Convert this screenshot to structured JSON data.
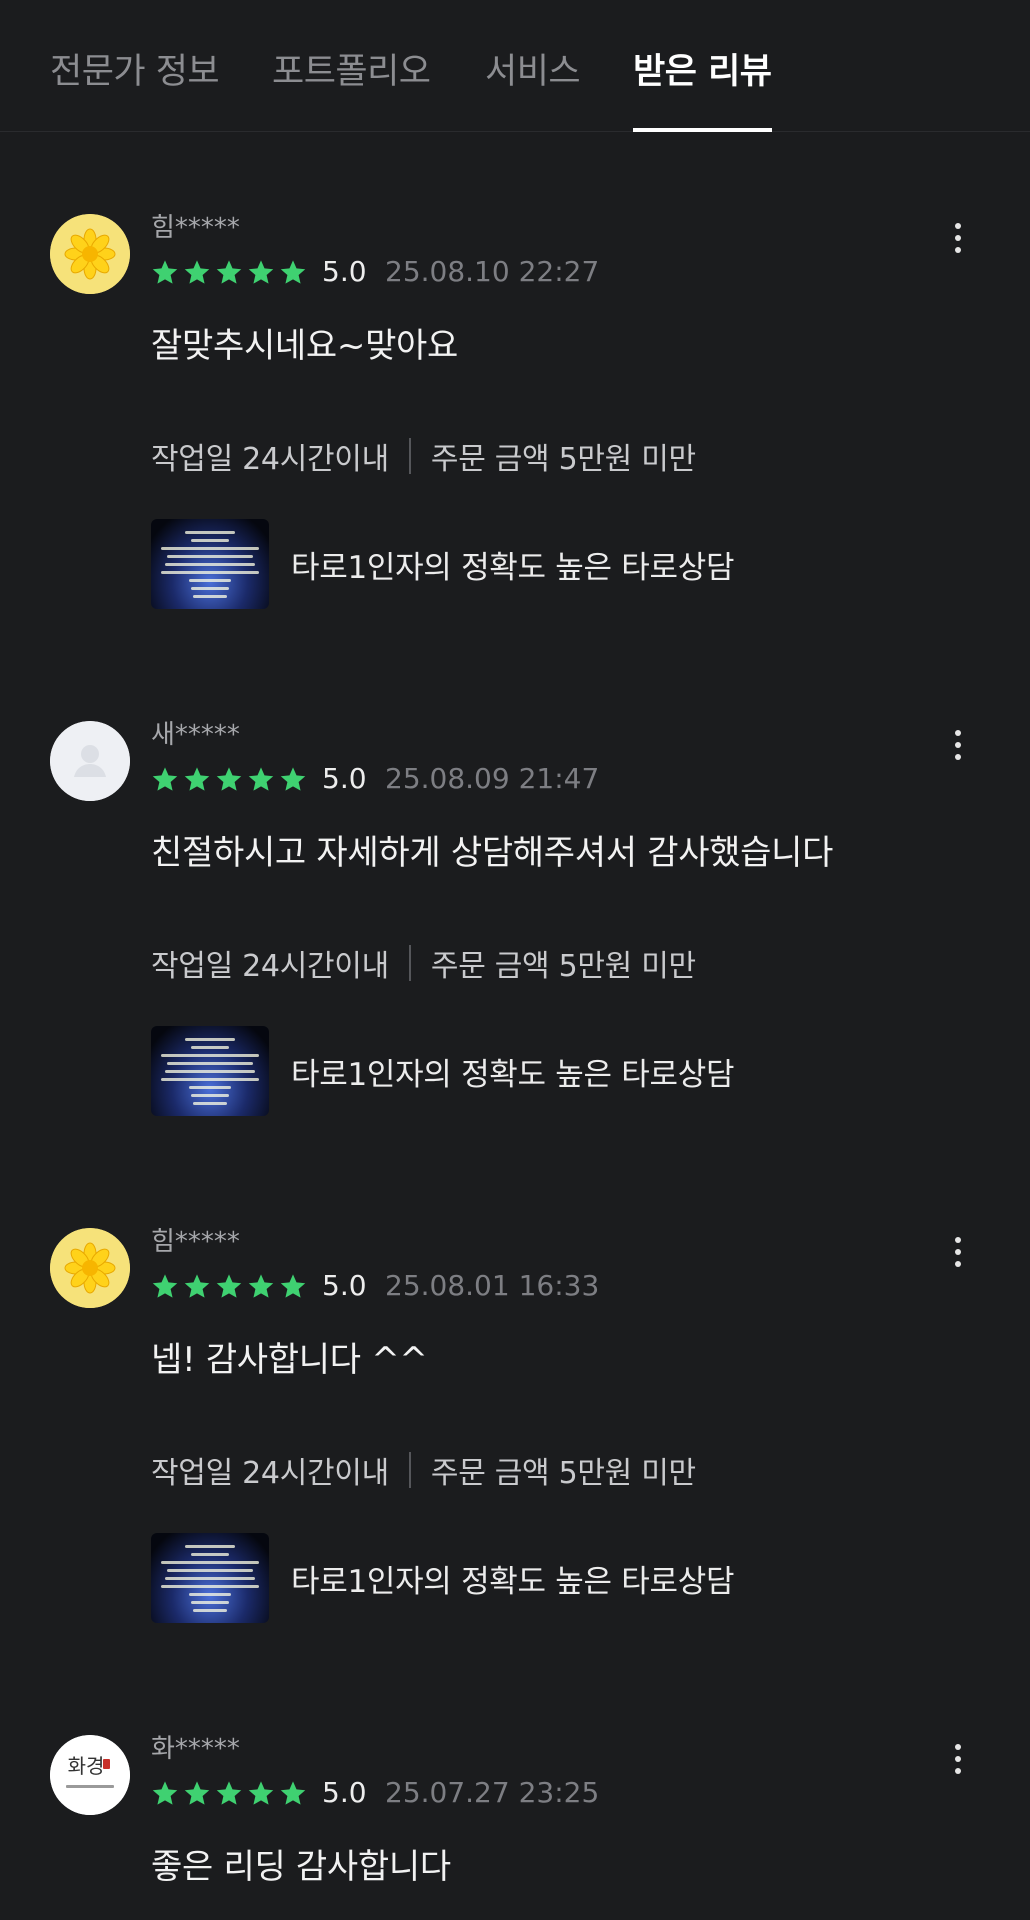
{
  "tabs": [
    {
      "label": "전문가 정보"
    },
    {
      "label": "포트폴리오"
    },
    {
      "label": "서비스"
    },
    {
      "label": "받은 리뷰"
    }
  ],
  "active_tab": "받은 리뷰",
  "colors": {
    "background": "#1b1c1e",
    "star": "#3fd171",
    "active_tab": "#ffffff",
    "inactive_tab": "#8c8d91"
  },
  "reviews": [
    {
      "avatar_icon": "flower-avatar-icon",
      "name": "힘*****",
      "rating_stars": 5,
      "score": "5.0",
      "date": "25.08.10 22:27",
      "comment": "잘맞추시네요~맞아요",
      "work_period": "작업일 24시간이내",
      "order_amount": "주문 금액 5만원 미만",
      "service_title": "타로1인자의 정확도 높은 타로상담"
    },
    {
      "avatar_icon": "default-user-avatar-icon",
      "name": "새*****",
      "rating_stars": 5,
      "score": "5.0",
      "date": "25.08.09 21:47",
      "comment": "친절하시고 자세하게 상담해주셔서 감사했습니다",
      "work_period": "작업일 24시간이내",
      "order_amount": "주문 금액 5만원 미만",
      "service_title": "타로1인자의 정확도 높은 타로상담"
    },
    {
      "avatar_icon": "flower-avatar-icon",
      "name": "힘*****",
      "rating_stars": 5,
      "score": "5.0",
      "date": "25.08.01 16:33",
      "comment": "넵! 감사합니다 ^^",
      "work_period": "작업일 24시간이내",
      "order_amount": "주문 금액 5만원 미만",
      "service_title": "타로1인자의 정확도 높은 타로상담"
    },
    {
      "avatar_icon": "brand-logo-avatar-icon",
      "avatar_text": "화경",
      "name": "화*****",
      "rating_stars": 5,
      "score": "5.0",
      "date": "25.07.27 23:25",
      "comment": "좋은 리딩 감사합니다"
    }
  ]
}
